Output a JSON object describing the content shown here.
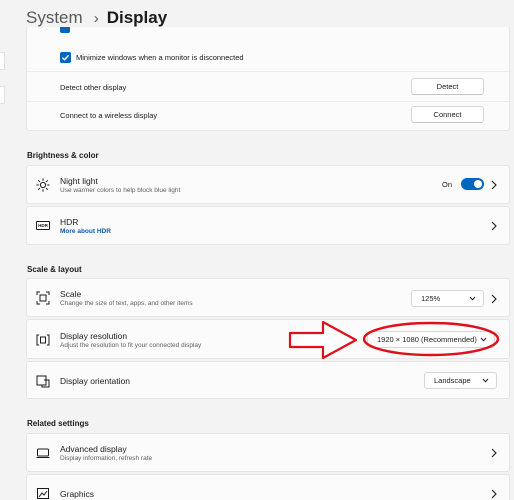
{
  "header": {
    "parent": "System",
    "separator": "›",
    "title": "Display"
  },
  "multi_display": {
    "minimize_label": "Minimize windows when a monitor is disconnected",
    "minimize_checked": true,
    "detect_label": "Detect other display",
    "detect_button": "Detect",
    "wireless_label": "Connect to a wireless display",
    "connect_button": "Connect"
  },
  "brightness": {
    "section_title": "Brightness & color",
    "night_light": {
      "title": "Night light",
      "subtitle": "Use warmer colors to help block blue light",
      "toggle_state": "On",
      "toggle_on": true
    },
    "hdr": {
      "title": "HDR",
      "link": "More about HDR",
      "icon_text": "HDR"
    }
  },
  "scale_layout": {
    "section_title": "Scale & layout",
    "scale": {
      "title": "Scale",
      "subtitle": "Change the size of text, apps, and other items",
      "value": "125%"
    },
    "resolution": {
      "title": "Display resolution",
      "subtitle": "Adjust the resolution to fit your connected display",
      "value": "1920 × 1080 (Recommended)"
    },
    "orientation": {
      "title": "Display orientation",
      "value": "Landscape"
    }
  },
  "related": {
    "section_title": "Related settings",
    "advanced": {
      "title": "Advanced display",
      "subtitle": "Display information, refresh rate"
    },
    "graphics": {
      "title": "Graphics"
    }
  },
  "colors": {
    "accent": "#0067c0",
    "annotation": "#e0101b"
  }
}
